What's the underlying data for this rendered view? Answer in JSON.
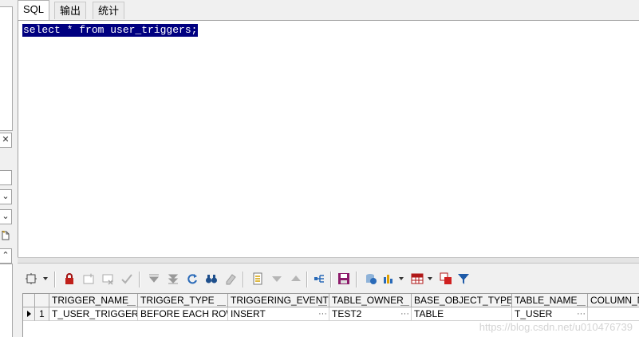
{
  "tabs": [
    {
      "label": "SQL",
      "active": true
    },
    {
      "label": "输出",
      "active": false
    },
    {
      "label": "统计",
      "active": false
    }
  ],
  "editor": {
    "sql": "select * from user_triggers;"
  },
  "left_strip": {
    "buttons": [
      {
        "icon": "close-icon",
        "glyph": "✕"
      },
      {
        "icon": "blank-box-icon",
        "glyph": ""
      },
      {
        "icon": "chevron-down-icon",
        "glyph": "⌄"
      },
      {
        "icon": "chevron-down-icon",
        "glyph": "⌄"
      },
      {
        "icon": "document-icon",
        "glyph": "▭"
      },
      {
        "icon": "chevron-up-icon",
        "glyph": "⌃"
      }
    ]
  },
  "toolbar": {
    "icons": [
      "grid-settings-icon",
      "lock-icon",
      "new-record-icon",
      "delete-record-icon",
      "post-check-icon",
      "first-record-icon",
      "last-record-icon",
      "refresh-icon",
      "find-icon",
      "eraser-icon",
      "single-record-view-icon",
      "previous-record-icon",
      "next-record-icon",
      "query-by-example-icon",
      "save-icon",
      "export-icon",
      "chart-icon",
      "table-view-icon",
      "compare-icon",
      "filter-icon"
    ]
  },
  "grid": {
    "columns": [
      "TRIGGER_NAME",
      "TRIGGER_TYPE",
      "TRIGGERING_EVENT",
      "TABLE_OWNER",
      "BASE_OBJECT_TYPE",
      "TABLE_NAME",
      "COLUMN_NAME"
    ],
    "rows": [
      {
        "index": "1",
        "cells": [
          "T_USER_TRIGGER",
          "BEFORE EACH ROW",
          "INSERT",
          "TEST2",
          "TABLE",
          "T_USER",
          ""
        ]
      }
    ],
    "ellipsis": "···"
  },
  "watermark": "https://blog.csdn.net/u010476739",
  "colors": {
    "selection": "#000080",
    "background": "#f0f0f0"
  }
}
